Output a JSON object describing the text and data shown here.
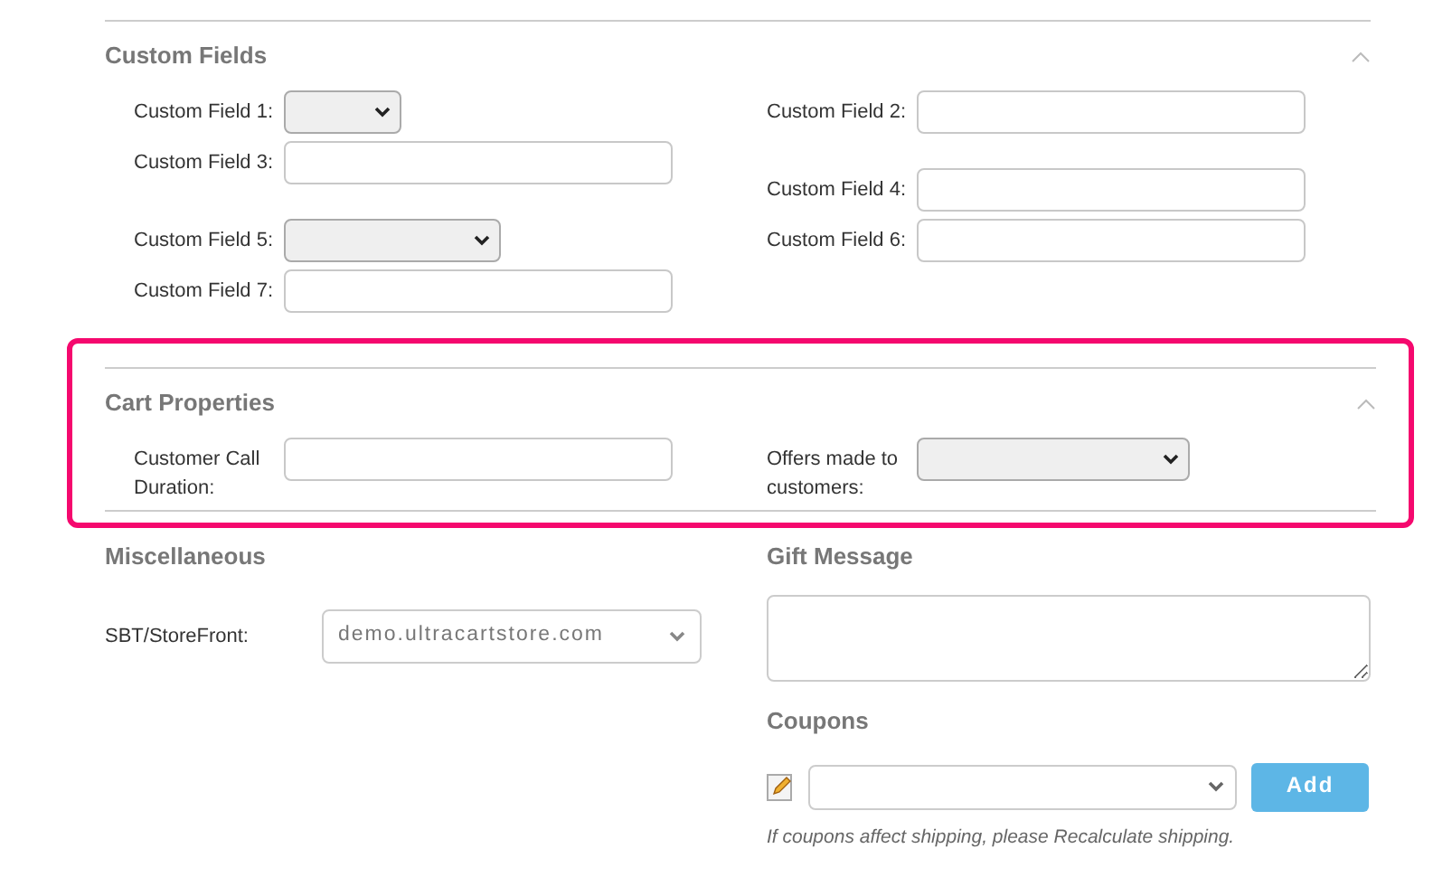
{
  "sections": [
    {
      "title": "Custom Fields",
      "expanded": true,
      "highlighted": false,
      "columns": [
        [
          {
            "label": "Custom Field 1:",
            "kind": "select"
          },
          {
            "label": "Custom Field 3:",
            "kind": "text"
          },
          {
            "label": "Custom Field 5:",
            "kind": "select"
          },
          {
            "label": "Custom Field 7:",
            "kind": "text"
          }
        ],
        [
          {
            "label": "Custom Field 2:",
            "kind": "text"
          },
          {
            "label": "Custom Field 4:",
            "kind": "text"
          },
          {
            "label": "Custom Field 6:",
            "kind": "text"
          }
        ]
      ]
    },
    {
      "title": "Cart Properties",
      "expanded": true,
      "highlighted": true,
      "columns": [
        [
          {
            "label": "Customer Call Duration:",
            "kind": "text"
          }
        ],
        [
          {
            "label": "Offers made to customers:",
            "kind": "select"
          }
        ]
      ]
    }
  ],
  "miscellaneous": {
    "title": "Miscellaneous",
    "storefront_label": "SBT/StoreFront:",
    "storefront_value": "demo.ultracartstore.com"
  },
  "gift_message": {
    "title": "Gift Message"
  },
  "coupons": {
    "title": "Coupons",
    "button": "Add",
    "note": "If coupons affect shipping, please Recalculate shipping."
  }
}
